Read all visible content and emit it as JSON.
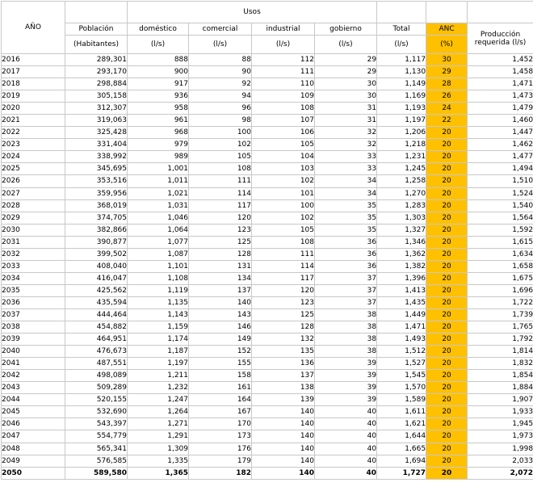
{
  "headers": {
    "year": "AÑO",
    "population": "Población",
    "population_unit": "(Habitantes)",
    "uses": "Usos",
    "domestic": "doméstico",
    "commercial": "comercial",
    "industrial": "industrial",
    "government": "gobierno",
    "total": "Total",
    "anc": "ANC",
    "anc_unit": "(%)",
    "production": "Producción requerida (l/s)",
    "flow_unit": "(l/s)"
  },
  "rows": [
    [
      "2016",
      "289,301",
      "888",
      "88",
      "112",
      "29",
      "1,117",
      "30",
      "1,452"
    ],
    [
      "2017",
      "293,170",
      "900",
      "90",
      "111",
      "29",
      "1,130",
      "29",
      "1,458"
    ],
    [
      "2018",
      "298,884",
      "917",
      "92",
      "110",
      "30",
      "1,149",
      "28",
      "1,471"
    ],
    [
      "2019",
      "305,158",
      "936",
      "94",
      "109",
      "30",
      "1,169",
      "26",
      "1,473"
    ],
    [
      "2020",
      "312,307",
      "958",
      "96",
      "108",
      "31",
      "1,193",
      "24",
      "1,479"
    ],
    [
      "2021",
      "319,063",
      "961",
      "98",
      "107",
      "31",
      "1,197",
      "22",
      "1,460"
    ],
    [
      "2022",
      "325,428",
      "968",
      "100",
      "106",
      "32",
      "1,206",
      "20",
      "1,447"
    ],
    [
      "2023",
      "331,404",
      "979",
      "102",
      "105",
      "32",
      "1,218",
      "20",
      "1,462"
    ],
    [
      "2024",
      "338,992",
      "989",
      "105",
      "104",
      "33",
      "1,231",
      "20",
      "1,477"
    ],
    [
      "2025",
      "345,695",
      "1,001",
      "108",
      "103",
      "33",
      "1,245",
      "20",
      "1,494"
    ],
    [
      "2026",
      "353,516",
      "1,011",
      "111",
      "102",
      "34",
      "1,258",
      "20",
      "1,510"
    ],
    [
      "2027",
      "359,956",
      "1,021",
      "114",
      "101",
      "34",
      "1,270",
      "20",
      "1,524"
    ],
    [
      "2028",
      "368,019",
      "1,031",
      "117",
      "100",
      "35",
      "1,283",
      "20",
      "1,540"
    ],
    [
      "2029",
      "374,705",
      "1,046",
      "120",
      "102",
      "35",
      "1,303",
      "20",
      "1,564"
    ],
    [
      "2030",
      "382,866",
      "1,064",
      "123",
      "105",
      "35",
      "1,327",
      "20",
      "1,592"
    ],
    [
      "2031",
      "390,877",
      "1,077",
      "125",
      "108",
      "36",
      "1,346",
      "20",
      "1,615"
    ],
    [
      "2032",
      "399,502",
      "1,087",
      "128",
      "111",
      "36",
      "1,362",
      "20",
      "1,634"
    ],
    [
      "2033",
      "408,040",
      "1,101",
      "131",
      "114",
      "36",
      "1,382",
      "20",
      "1,658"
    ],
    [
      "2034",
      "416,047",
      "1,108",
      "134",
      "117",
      "37",
      "1,396",
      "20",
      "1,675"
    ],
    [
      "2035",
      "425,562",
      "1,119",
      "137",
      "120",
      "37",
      "1,413",
      "20",
      "1,696"
    ],
    [
      "2036",
      "435,594",
      "1,135",
      "140",
      "123",
      "37",
      "1,435",
      "20",
      "1,722"
    ],
    [
      "2037",
      "444,464",
      "1,143",
      "143",
      "125",
      "38",
      "1,449",
      "20",
      "1,739"
    ],
    [
      "2038",
      "454,882",
      "1,159",
      "146",
      "128",
      "38",
      "1,471",
      "20",
      "1,765"
    ],
    [
      "2039",
      "464,951",
      "1,174",
      "149",
      "132",
      "38",
      "1,493",
      "20",
      "1,792"
    ],
    [
      "2040",
      "476,673",
      "1,187",
      "152",
      "135",
      "38",
      "1,512",
      "20",
      "1,814"
    ],
    [
      "2041",
      "487,551",
      "1,197",
      "155",
      "136",
      "39",
      "1,527",
      "20",
      "1,832"
    ],
    [
      "2042",
      "498,089",
      "1,211",
      "158",
      "137",
      "39",
      "1,545",
      "20",
      "1,854"
    ],
    [
      "2043",
      "509,289",
      "1,232",
      "161",
      "138",
      "39",
      "1,570",
      "20",
      "1,884"
    ],
    [
      "2044",
      "520,155",
      "1,247",
      "164",
      "139",
      "39",
      "1,589",
      "20",
      "1,907"
    ],
    [
      "2045",
      "532,690",
      "1,264",
      "167",
      "140",
      "40",
      "1,611",
      "20",
      "1,933"
    ],
    [
      "2046",
      "543,397",
      "1,271",
      "170",
      "140",
      "40",
      "1,621",
      "20",
      "1,945"
    ],
    [
      "2047",
      "554,779",
      "1,291",
      "173",
      "140",
      "40",
      "1,644",
      "20",
      "1,973"
    ],
    [
      "2048",
      "565,341",
      "1,309",
      "176",
      "140",
      "40",
      "1,665",
      "20",
      "1,998"
    ],
    [
      "2049",
      "576,585",
      "1,335",
      "179",
      "140",
      "40",
      "1,694",
      "20",
      "2,033"
    ],
    [
      "2050",
      "589,580",
      "1,365",
      "182",
      "140",
      "40",
      "1,727",
      "20",
      "2,072"
    ]
  ],
  "colors": {
    "anc_highlight": "#ffc000",
    "grid": "#c8c8c8"
  }
}
